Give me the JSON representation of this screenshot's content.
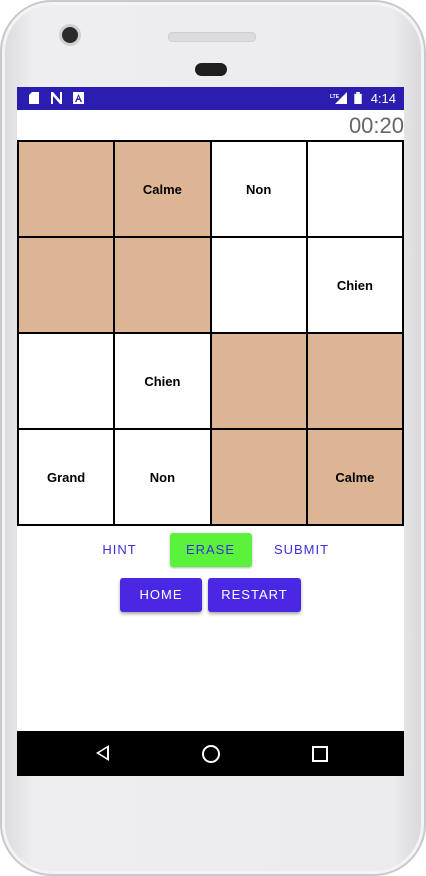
{
  "status_bar": {
    "time": "4:14",
    "left_icons": [
      "sd-card-icon",
      "n-icon",
      "a-icon"
    ],
    "right_icons": [
      "lte-icon",
      "signal-icon",
      "battery-icon"
    ]
  },
  "timer": "00:20",
  "grid": {
    "cells": [
      {
        "text": "",
        "color": "tan"
      },
      {
        "text": "Calme",
        "color": "tan"
      },
      {
        "text": "Non",
        "color": "white"
      },
      {
        "text": "",
        "color": "white"
      },
      {
        "text": "",
        "color": "tan"
      },
      {
        "text": "",
        "color": "tan"
      },
      {
        "text": "",
        "color": "white"
      },
      {
        "text": "Chien",
        "color": "white"
      },
      {
        "text": "",
        "color": "white"
      },
      {
        "text": "Chien",
        "color": "white"
      },
      {
        "text": "",
        "color": "tan"
      },
      {
        "text": "",
        "color": "tan"
      },
      {
        "text": "Grand",
        "color": "white"
      },
      {
        "text": "Non",
        "color": "white"
      },
      {
        "text": "",
        "color": "tan"
      },
      {
        "text": "Calme",
        "color": "tan"
      }
    ],
    "colors": {
      "tan": "#dcb595",
      "white": "#ffffff"
    }
  },
  "actions": {
    "hint": "HINT",
    "erase": "ERASE",
    "submit": "SUBMIT",
    "home": "HOME",
    "restart": "RESTART"
  },
  "colors": {
    "status_bar": "#2a1db0",
    "accent": "#4a28e3",
    "erase_bg": "#5af23a"
  }
}
